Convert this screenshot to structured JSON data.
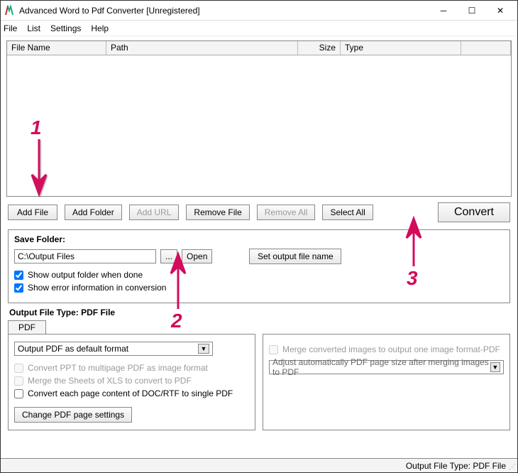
{
  "window": {
    "title": "Advanced Word to Pdf Converter [Unregistered]"
  },
  "menu": {
    "file": "File",
    "list": "List",
    "settings": "Settings",
    "help": "Help"
  },
  "columns": {
    "filename": "File Name",
    "path": "Path",
    "size": "Size",
    "type": "Type"
  },
  "buttons": {
    "addfile": "Add File",
    "addfolder": "Add Folder",
    "addurl": "Add URL",
    "removefile": "Remove File",
    "removeall": "Remove All",
    "selectall": "Select All",
    "convert": "Convert",
    "browse": "...",
    "open": "Open",
    "setoutname": "Set output file name",
    "changepdf": "Change PDF page settings"
  },
  "save": {
    "title": "Save Folder:",
    "path": "C:\\Output Files",
    "showfolder": "Show output folder when done",
    "showerror": "Show error information in conversion"
  },
  "outtype": {
    "label": "Output File Type:  PDF File",
    "tab": "PDF"
  },
  "leftopts": {
    "format_select": "Output PDF as default format",
    "ppt_multi": "Convert PPT to multipage PDF as image format",
    "xls_merge": "Merge the Sheets of XLS to convert to PDF",
    "doc_single": "Convert each page content of DOC/RTF to single PDF"
  },
  "rightopts": {
    "merge_images": "Merge converted images to output one image format-PDF",
    "adjust_select": "Adjust automatically PDF page size after merging images to PDF"
  },
  "status": {
    "text": "Output File Type:  PDF File"
  },
  "annotations": {
    "n1": "1",
    "n2": "2",
    "n3": "3"
  }
}
